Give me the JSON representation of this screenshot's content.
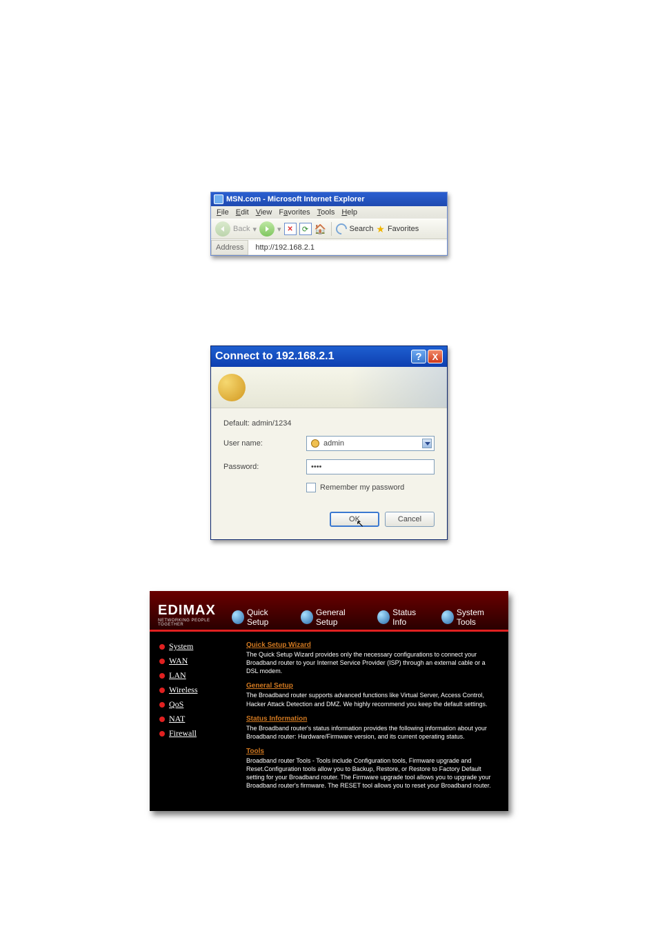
{
  "ie": {
    "title": "MSN.com - Microsoft Internet Explorer",
    "menu": {
      "file": "File",
      "edit": "Edit",
      "view": "View",
      "favorites": "Favorites",
      "tools": "Tools",
      "help": "Help"
    },
    "toolbar": {
      "back": "Back",
      "search": "Search",
      "favorites": "Favorites"
    },
    "address_label": "Address",
    "address_value": "http://192.168.2.1"
  },
  "auth": {
    "title": "Connect to 192.168.2.1",
    "realm": "Default: admin/1234",
    "user_label": "User name:",
    "user_value": "admin",
    "pass_label": "Password:",
    "pass_value": "••••",
    "remember": "Remember my password",
    "ok": "OK",
    "cancel": "Cancel"
  },
  "router": {
    "logo_text": "EDIMAX",
    "logo_tag": "NETWORKING PEOPLE TOGETHER",
    "tabs": {
      "quick": "Quick Setup",
      "general": "General Setup",
      "status": "Status Info",
      "tools": "System Tools"
    },
    "side": [
      "System",
      "WAN",
      "LAN",
      "Wireless",
      "QoS",
      "NAT",
      "Firewall"
    ],
    "sections": {
      "quick": {
        "title": "Quick Setup Wizard",
        "body": "The Quick Setup Wizard provides only the necessary configurations to connect your Broadband router to your Internet Service Provider (ISP) through an external cable or a DSL modem."
      },
      "general": {
        "title": "General Setup",
        "body": "The Broadband router supports advanced functions like Virtual Server, Access Control, Hacker Attack Detection and DMZ. We highly recommend you keep the default settings."
      },
      "status": {
        "title": "Status Information",
        "body": "The Broadband router's status information provides the following information about your Broadband router: Hardware/Firmware version, and its current operating status."
      },
      "tools": {
        "title": "Tools",
        "body": "Broadband router Tools - Tools include Configuration tools, Firmware upgrade and Reset.Configuration tools allow you to Backup, Restore, or Restore to Factory Default setting for your Broadband router. The Firmware upgrade tool allows you to upgrade your Broadband router's firmware. The RESET tool allows you to reset your Broadband router."
      }
    }
  }
}
